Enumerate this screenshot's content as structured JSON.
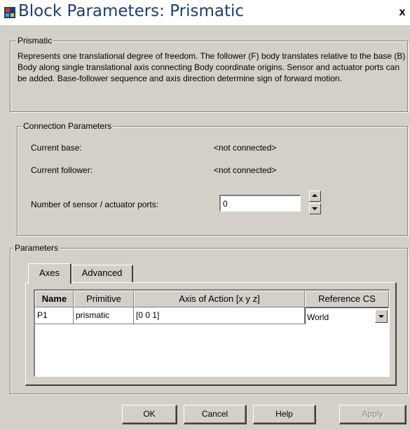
{
  "window": {
    "title": "Block Parameters: Prismatic",
    "close_glyph": "x",
    "icon": "simulink-block-icon"
  },
  "prismatic_group": {
    "legend": "Prismatic",
    "description": "Represents one translational degree of freedom. The follower (F) body translates relative to the base (B) Body along single translational axis connecting Body coordinate origins. Sensor and actuator ports can be added. Base-follower sequence and axis direction determine sign of forward motion."
  },
  "connection": {
    "legend": "Connection Parameters",
    "base_label": "Current base:",
    "base_value": "<not connected>",
    "follower_label": "Current follower:",
    "follower_value": "<not connected>",
    "ports_label": "Number of sensor / actuator ports:",
    "ports_value": "0"
  },
  "parameters": {
    "legend": "Parameters",
    "tabs": [
      {
        "label": "Axes",
        "active": true
      },
      {
        "label": "Advanced",
        "active": false
      }
    ],
    "table": {
      "headers": [
        "Name",
        "Primitive",
        "Axis of Action [x y z]",
        "Reference CS"
      ],
      "rows": [
        {
          "name": "P1",
          "primitive": "prismatic",
          "axis": "[0 0 1]",
          "reference": "World"
        }
      ]
    }
  },
  "buttons": {
    "ok": "OK",
    "cancel": "Cancel",
    "help": "Help",
    "apply": "Apply"
  },
  "colors": {
    "dialog_bg": "#d4d0c8",
    "title_text": "#1c3e78",
    "disabled_text": "#808080"
  }
}
